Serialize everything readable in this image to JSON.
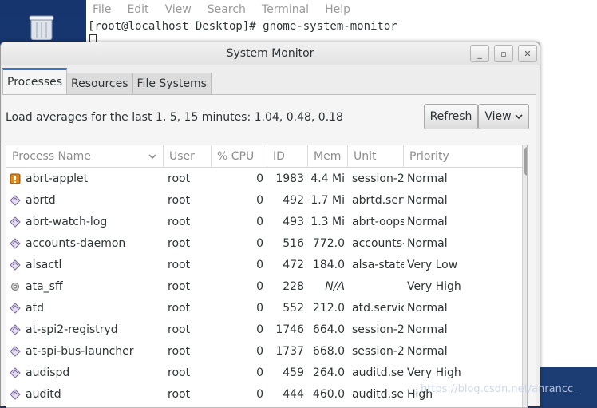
{
  "terminal": {
    "menu": [
      "File",
      "Edit",
      "View",
      "Search",
      "Terminal",
      "Help"
    ],
    "prompt": "[root@localhost Desktop]# gnome-system-monitor"
  },
  "window": {
    "title": "System Monitor",
    "controls": {
      "minimize": "_",
      "maximize": "▫",
      "close": "✕"
    }
  },
  "tabs": [
    "Processes",
    "Resources",
    "File Systems"
  ],
  "active_tab": "Processes",
  "load_text": "Load averages for the last 1, 5, 15 minutes: 1.04, 0.48, 0.18",
  "buttons": {
    "refresh": "Refresh",
    "view": "View"
  },
  "table": {
    "headers": [
      "Process Name",
      "User",
      "% CPU",
      "ID",
      "Mem",
      "Unit",
      "Priority"
    ],
    "rows": [
      {
        "icon": "alert-icon",
        "name": "abrt-applet",
        "user": "root",
        "cpu": "0",
        "id": "1983",
        "mem": "4.4 Mi",
        "unit": "session-2",
        "priority": "Normal"
      },
      {
        "icon": "diamond-icon",
        "name": "abrtd",
        "user": "root",
        "cpu": "0",
        "id": "492",
        "mem": "1.7 Mi",
        "unit": "abrtd.serv",
        "priority": "Normal"
      },
      {
        "icon": "diamond-icon",
        "name": "abrt-watch-log",
        "user": "root",
        "cpu": "0",
        "id": "493",
        "mem": "1.3 Mi",
        "unit": "abrt-oops",
        "priority": "Normal"
      },
      {
        "icon": "diamond-icon",
        "name": "accounts-daemon",
        "user": "root",
        "cpu": "0",
        "id": "516",
        "mem": "772.0",
        "unit": "accounts-",
        "priority": "Normal"
      },
      {
        "icon": "diamond-icon",
        "name": "alsactl",
        "user": "root",
        "cpu": "0",
        "id": "472",
        "mem": "184.0",
        "unit": "alsa-state",
        "priority": "Very Low"
      },
      {
        "icon": "gear-icon",
        "name": "ata_sff",
        "user": "root",
        "cpu": "0",
        "id": "228",
        "mem": "N/A",
        "unit": "",
        "priority": "Very High"
      },
      {
        "icon": "diamond-icon",
        "name": "atd",
        "user": "root",
        "cpu": "0",
        "id": "552",
        "mem": "212.0",
        "unit": "atd.servic",
        "priority": "Normal"
      },
      {
        "icon": "diamond-icon",
        "name": "at-spi2-registryd",
        "user": "root",
        "cpu": "0",
        "id": "1746",
        "mem": "664.0",
        "unit": "session-2",
        "priority": "Normal"
      },
      {
        "icon": "diamond-icon",
        "name": "at-spi-bus-launcher",
        "user": "root",
        "cpu": "0",
        "id": "1737",
        "mem": "668.0",
        "unit": "session-2",
        "priority": "Normal"
      },
      {
        "icon": "diamond-icon",
        "name": "audispd",
        "user": "root",
        "cpu": "0",
        "id": "459",
        "mem": "264.0",
        "unit": "auditd.ser",
        "priority": "Very High"
      },
      {
        "icon": "diamond-icon",
        "name": "auditd",
        "user": "root",
        "cpu": "0",
        "id": "444",
        "mem": "460.0",
        "unit": "auditd.ser",
        "priority": "High"
      }
    ]
  },
  "watermark": "https://blog.csdn.net/anrancc_",
  "colors": {
    "accent": "#3f74b6",
    "desktop": "#1f3a6e"
  }
}
